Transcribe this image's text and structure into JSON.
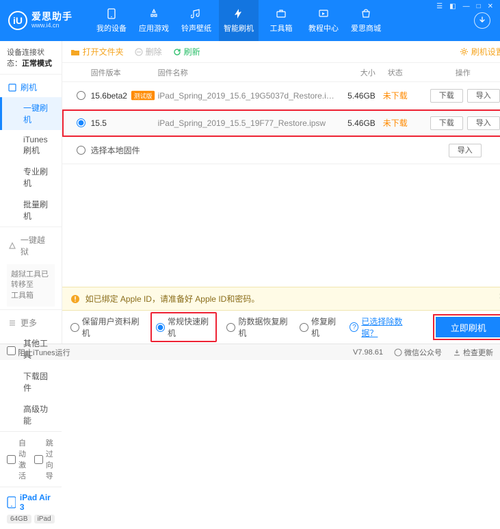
{
  "header": {
    "app_name_cn": "爱思助手",
    "app_url": "www.i4.cn",
    "nav": [
      {
        "key": "device",
        "label": "我的设备"
      },
      {
        "key": "apps",
        "label": "应用游戏"
      },
      {
        "key": "ringtone",
        "label": "铃声壁纸"
      },
      {
        "key": "flash",
        "label": "智能刷机"
      },
      {
        "key": "tools",
        "label": "工具箱"
      },
      {
        "key": "tutorial",
        "label": "教程中心"
      },
      {
        "key": "mall",
        "label": "爱思商城"
      }
    ],
    "active_nav": "flash"
  },
  "sidebar": {
    "status_label": "设备连接状态：",
    "status_value": "正常模式",
    "groups": {
      "flash": {
        "title": "刷机",
        "items": [
          {
            "key": "oneclick",
            "label": "一键刷机"
          },
          {
            "key": "itunes",
            "label": "iTunes刷机"
          },
          {
            "key": "pro",
            "label": "专业刷机"
          },
          {
            "key": "batch",
            "label": "批量刷机"
          }
        ],
        "active": "oneclick"
      },
      "jailbreak": {
        "title": "一键越狱",
        "note": "越狱工具已转移至\n工具箱"
      },
      "more": {
        "title": "更多",
        "items": [
          {
            "key": "other",
            "label": "其他工具"
          },
          {
            "key": "dlfw",
            "label": "下载固件"
          },
          {
            "key": "adv",
            "label": "高级功能"
          }
        ]
      }
    },
    "foot": {
      "auto_activate": "自动激活",
      "skip_guide": "跳过向导"
    },
    "device": {
      "name": "iPad Air 3",
      "storage": "64GB",
      "model": "iPad"
    }
  },
  "toolbar": {
    "open_folder": "打开文件夹",
    "delete": "删除",
    "refresh": "刷新",
    "settings": "刷机设置"
  },
  "table": {
    "headers": {
      "version": "固件版本",
      "name": "固件名称",
      "size": "大小",
      "status": "状态",
      "ops": "操作"
    },
    "rows": [
      {
        "version": "15.6beta2",
        "beta_tag": "测试版",
        "name": "iPad_Spring_2019_15.6_19G5037d_Restore.i…",
        "size": "5.46GB",
        "status": "未下载",
        "dl": "下载",
        "imp": "导入",
        "selected": false,
        "highlight": false
      },
      {
        "version": "15.5",
        "beta_tag": "",
        "name": "iPad_Spring_2019_15.5_19F77_Restore.ipsw",
        "size": "5.46GB",
        "status": "未下载",
        "dl": "下载",
        "imp": "导入",
        "selected": true,
        "highlight": true
      }
    ],
    "local": {
      "label": "选择本地固件",
      "import": "导入"
    }
  },
  "warning": {
    "text": "如已绑定 Apple ID，请准备好 Apple ID和密码。"
  },
  "options": {
    "keep_data": "保留用户资料刷机",
    "normal": "常规快速刷机",
    "recovery": "防数据恢复刷机",
    "repair": "修复刷机",
    "exclude_link": "已选择除数据？",
    "go": "立即刷机",
    "selected": "normal"
  },
  "footer": {
    "block_itunes": "阻止iTunes运行",
    "version": "V7.98.61",
    "wechat": "微信公众号",
    "update": "检查更新"
  }
}
